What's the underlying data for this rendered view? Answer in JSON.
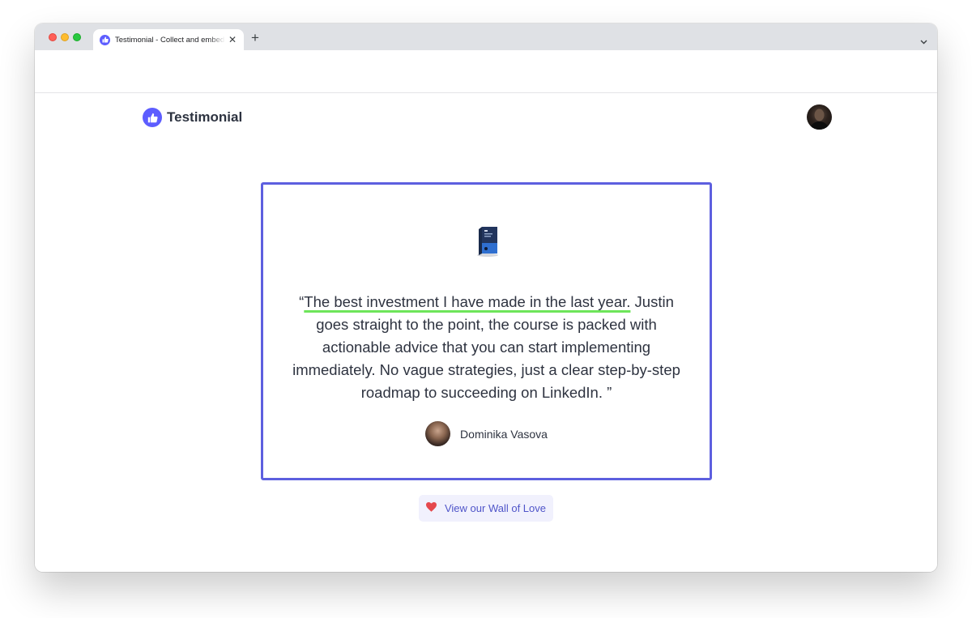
{
  "browser": {
    "tab_title": "Testimonial - Collect and embed testimonials",
    "close_symbol": "✕",
    "new_tab_symbol": "+"
  },
  "header": {
    "brand_name": "Testimonial",
    "logo_icon": "thumbs-up-icon"
  },
  "testimonial": {
    "quote_open": "“",
    "quote_highlight": "The best investment I have made in the last year.",
    "quote_rest": " Justin goes straight to the point, the course is packed with actionable advice that you can start implementing immediately. No vague strategies, just a clear step-by-step roadmap to succeeding on LinkedIn. ",
    "quote_close": "”",
    "author_name": "Dominika Vasova"
  },
  "cta": {
    "label": "View our Wall of Love",
    "icon": "heart-icon"
  },
  "colors": {
    "accent": "#5d5fdf",
    "brand": "#5d5dff",
    "highlight": "#6ee55a",
    "heart": "#e5484d",
    "cta_bg": "#f1f1fd"
  }
}
